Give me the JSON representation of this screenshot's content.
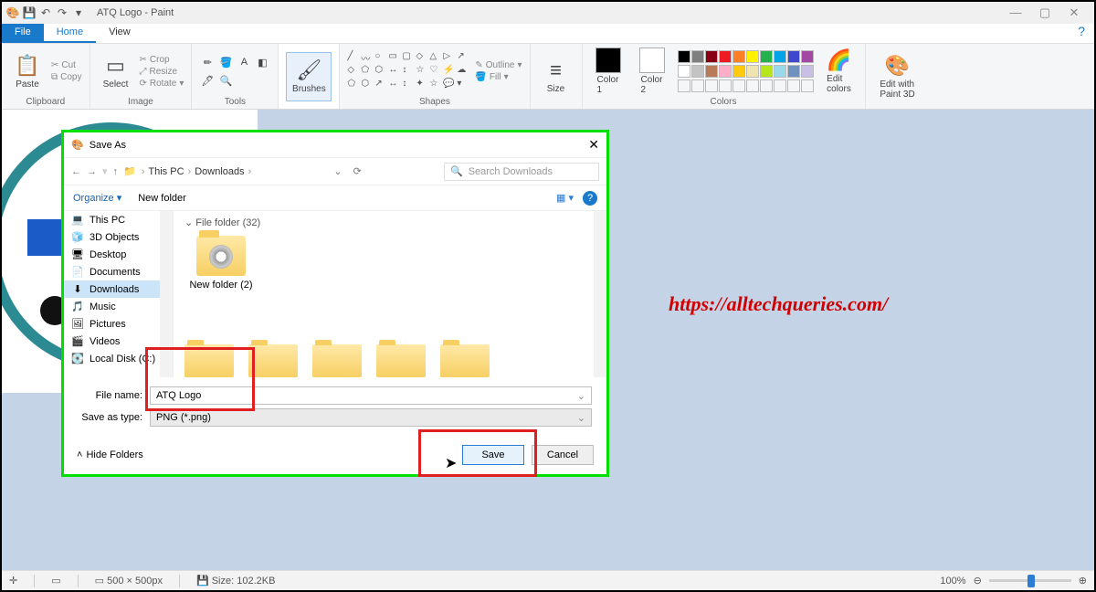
{
  "title": {
    "doc": "ATQ Logo",
    "app": "Paint"
  },
  "win": {
    "min": "—",
    "max": "▢",
    "close": "✕"
  },
  "tabs": {
    "file": "File",
    "home": "Home",
    "view": "View"
  },
  "ribbon": {
    "clipboard": {
      "paste": "Paste",
      "cut": "Cut",
      "copy": "Copy",
      "label": "Clipboard"
    },
    "image": {
      "select": "Select",
      "crop": "Crop",
      "resize": "Resize",
      "rotate": "Rotate",
      "label": "Image"
    },
    "tools": {
      "label": "Tools"
    },
    "brushes": "Brushes",
    "shapes": {
      "outline": "Outline",
      "fill": "Fill",
      "label": "Shapes"
    },
    "size": "Size",
    "color1": "Color\n1",
    "color2": "Color\n2",
    "colors_label": "Colors",
    "edit_colors": "Edit\ncolors",
    "paint3d": "Edit with\nPaint 3D"
  },
  "watermark": "https://alltechqueries.com/",
  "dialog": {
    "title": "Save As",
    "back": "←",
    "fwd": "→",
    "up": "↑",
    "crumbs": [
      "This PC",
      "Downloads"
    ],
    "refresh": "⟳",
    "search_placeholder": "Search Downloads",
    "organize": "Organize",
    "new_folder": "New folder",
    "tree": [
      {
        "ico": "💻",
        "label": "This PC"
      },
      {
        "ico": "🧊",
        "label": "3D Objects"
      },
      {
        "ico": "🖥",
        "label": "Desktop"
      },
      {
        "ico": "📄",
        "label": "Documents"
      },
      {
        "ico": "⬇",
        "label": "Downloads",
        "sel": true
      },
      {
        "ico": "🎵",
        "label": "Music"
      },
      {
        "ico": "🖼",
        "label": "Pictures"
      },
      {
        "ico": "🎬",
        "label": "Videos"
      },
      {
        "ico": "💽",
        "label": "Local Disk (C:)"
      }
    ],
    "group_header": "File folder (32)",
    "folder_name": "New folder (2)",
    "filename_label": "File name:",
    "filename_value": "ATQ Logo",
    "savetype_label": "Save as type:",
    "savetype_value": "PNG (*.png)",
    "hide_folders": "Hide Folders",
    "save": "Save",
    "cancel": "Cancel"
  },
  "status": {
    "dims": "500 × 500px",
    "size": "Size: 102.2KB",
    "zoom": "100%"
  },
  "palette_top": [
    "#000000",
    "#7f7f7f",
    "#880015",
    "#ed1c24",
    "#ff7f27",
    "#fff200",
    "#22b14c",
    "#00a2e8",
    "#3f48cc",
    "#a349a4"
  ],
  "palette_bot": [
    "#ffffff",
    "#c3c3c3",
    "#b97a57",
    "#ffaec9",
    "#ffc90e",
    "#efe4b0",
    "#b5e61d",
    "#99d9ea",
    "#7092be",
    "#c8bfe7"
  ]
}
